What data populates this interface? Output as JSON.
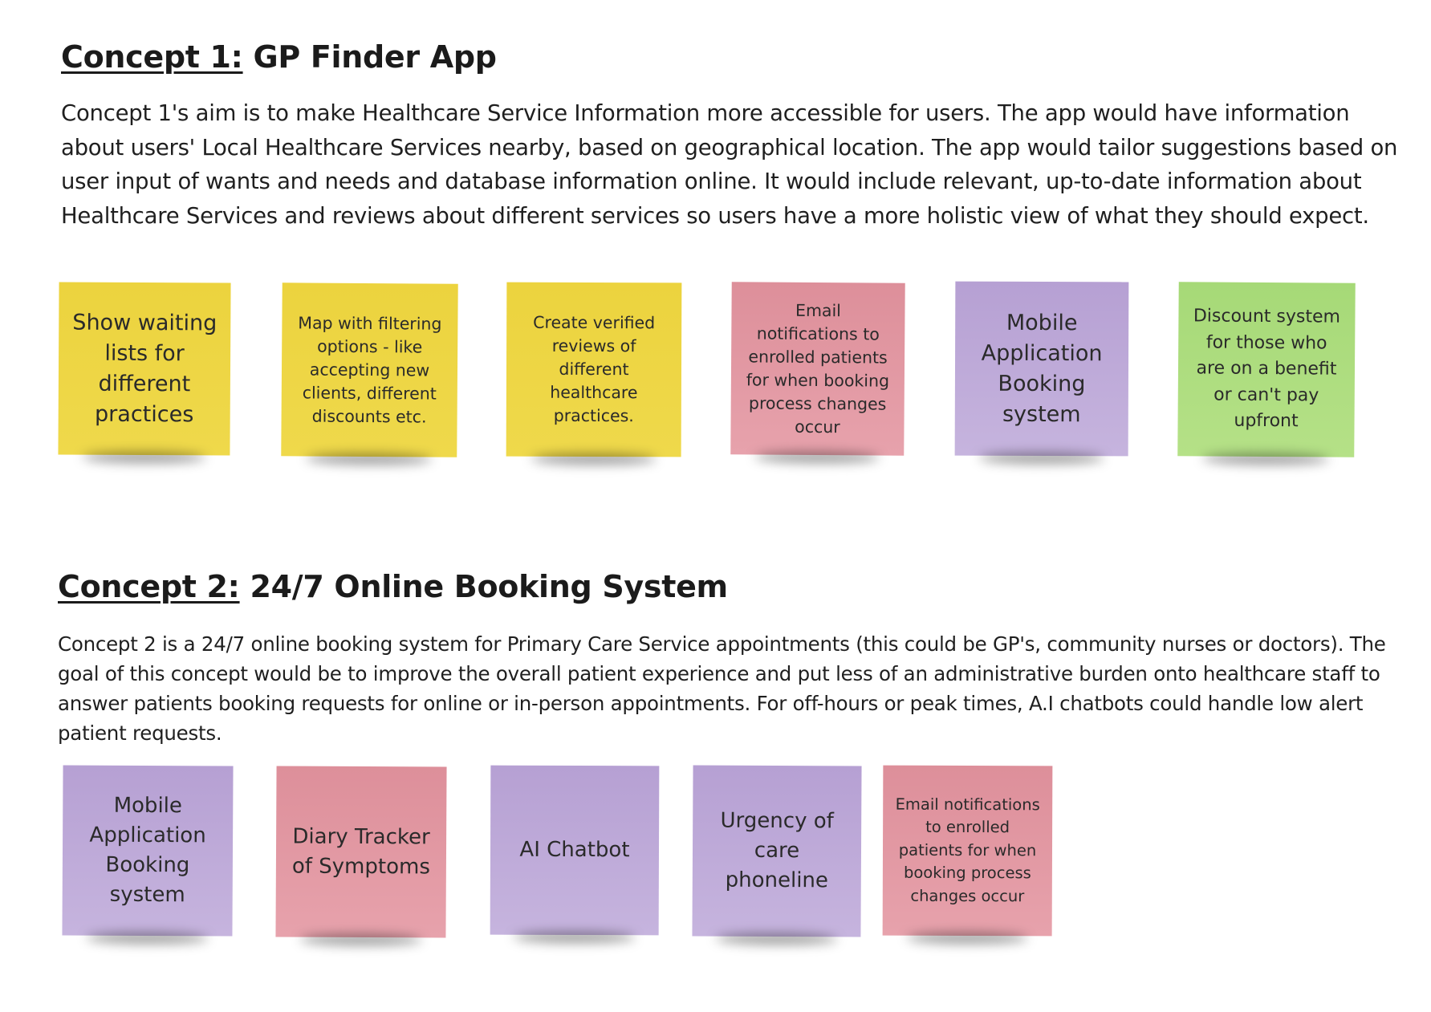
{
  "concept1": {
    "label": "Concept 1:",
    "title": " GP Finder App",
    "description": "Concept 1's aim is to make Healthcare Service Information more accessible for users. The app would have information about users' Local Healthcare Services nearby, based on geographical location. The app would tailor suggestions based on user input of wants and needs and database information online. It would include relevant, up-to-date information about Healthcare Services and reviews about different services so users have a more holistic view of what they should expect.",
    "notes": [
      {
        "text": "Show waiting lists for different practices",
        "color": "#ecd33e"
      },
      {
        "text": "Map with filtering options - like accepting new clients, different discounts etc.",
        "color": "#ecd33e"
      },
      {
        "text": "Create verified reviews of different healthcare practices.",
        "color": "#ecd33e"
      },
      {
        "text": "Email notifications to enrolled patients for when booking process changes occur",
        "color": "#dd8f9a"
      },
      {
        "text": "Mobile Application Booking system",
        "color": "#b6a0d3"
      },
      {
        "text": "Discount system for those who are on a benefit or can't pay upfront",
        "color": "#a6d977"
      }
    ]
  },
  "concept2": {
    "label": "Concept 2:",
    "title": " 24/7 Online Booking System",
    "description": "Concept 2 is a 24/7 online booking system for Primary Care Service appointments (this could be GP's, community nurses or doctors). The goal of this concept would be to improve the overall patient experience and put less of an administrative burden onto healthcare staff to answer patients booking requests for online or in-person appointments. For off-hours or peak times, A.I chatbots could handle low alert patient requests.",
    "notes": [
      {
        "text": "Mobile Application Booking system",
        "color": "#b6a0d3"
      },
      {
        "text": "Diary Tracker of Symptoms",
        "color": "#dd8f9a"
      },
      {
        "text": "AI Chatbot",
        "color": "#b6a0d3"
      },
      {
        "text": "Urgency of care phoneline",
        "color": "#b6a0d3"
      },
      {
        "text": "Email notifications to enrolled patients for when booking process changes occur",
        "color": "#dd8f9a"
      }
    ]
  }
}
